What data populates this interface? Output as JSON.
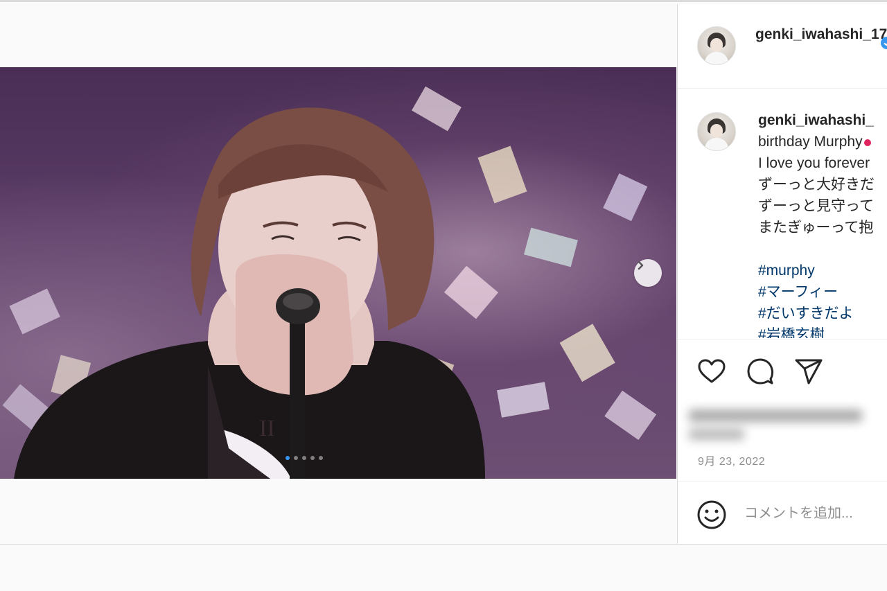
{
  "header": {
    "username": "genki_iwahashi_17"
  },
  "caption": {
    "username": "genki_iwahashi_",
    "lines": [
      "birthday Murphy",
      "I love you forever",
      "ずーっと大好きだ",
      "ずーっと見守って",
      "またぎゅーって抱"
    ],
    "hashtags": [
      "#murphy",
      "#マーフィー",
      "#だいすきだよ",
      "#岩橋玄樹"
    ]
  },
  "icons": {
    "next": "chevron-right-icon",
    "like": "heart-icon",
    "comment": "comment-icon",
    "share": "share-icon",
    "emoji": "smiley-icon",
    "verified": "verified-badge-icon"
  },
  "post": {
    "date": "9月 23, 2022"
  },
  "comment": {
    "placeholder": "コメントを追加..."
  },
  "colors": {
    "link": "#00376b",
    "verified": "#3897f0",
    "muted": "#8e8e8e",
    "carousel_active": "#3797f0"
  }
}
